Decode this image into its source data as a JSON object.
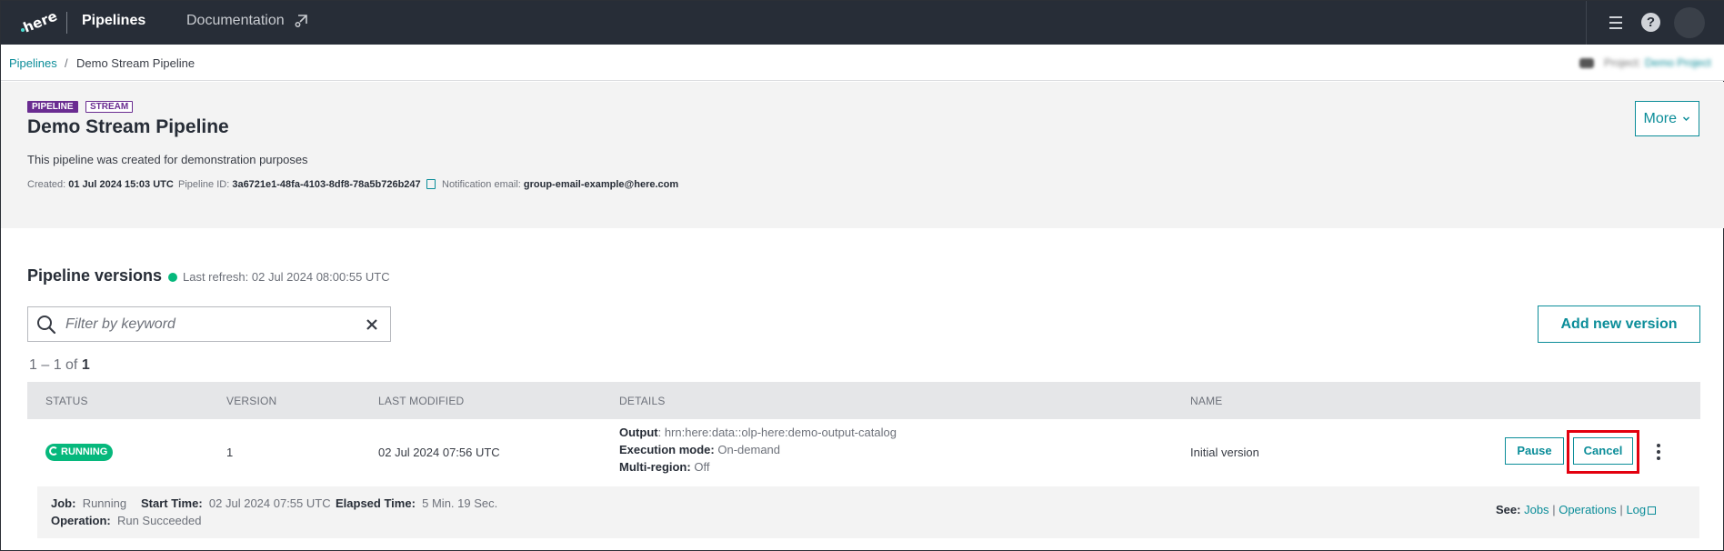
{
  "topbar": {
    "logo_text": "here",
    "app_title": "Pipelines",
    "documentation_label": "Documentation"
  },
  "breadcrumb": {
    "root": "Pipelines",
    "separator": "/",
    "current": "Demo Stream Pipeline",
    "project_label": "Project:",
    "project_value": "Demo Project"
  },
  "pipeline": {
    "tag_pipeline": "PIPELINE",
    "tag_stream": "STREAM",
    "title": "Demo Stream Pipeline",
    "description": "This pipeline was created for demonstration purposes",
    "created_label": "Created:",
    "created_value": "01 Jul 2024 15:03 UTC",
    "id_label": "Pipeline ID:",
    "id_value": "3a6721e1-48fa-4103-8df8-78a5b726b247",
    "email_label": "Notification email:",
    "email_value": "group-email-example@here.com",
    "more_label": "More"
  },
  "versions": {
    "title": "Pipeline versions",
    "last_refresh": "Last refresh: 02 Jul 2024 08:00:55 UTC",
    "search_placeholder": "Filter by keyword",
    "add_label": "Add new version",
    "count_prefix": "1 – 1 of",
    "count_total": "1",
    "columns": [
      "STATUS",
      "VERSION",
      "LAST MODIFIED",
      "DETAILS",
      "NAME"
    ],
    "rows": [
      {
        "status": "RUNNING",
        "version": "1",
        "last_modified": "02 Jul 2024 07:56 UTC",
        "output_label": "Output",
        "output_value": ": hrn:here:data::olp-here:demo-output-catalog",
        "exec_label": "Execution mode:",
        "exec_value": " On-demand",
        "region_label": "Multi-region:",
        "region_value": " Off",
        "name": "Initial version",
        "pause_label": "Pause",
        "cancel_label": "Cancel",
        "job_label": "Job:",
        "job_value": "Running",
        "start_label": "Start Time:",
        "start_value": "02 Jul 2024 07:55 UTC",
        "elapsed_label": "Elapsed Time:",
        "elapsed_value": "5 Min. 19 Sec.",
        "operation_label": "Operation:",
        "operation_value": "Run Succeeded",
        "see_label": "See:",
        "link_jobs": "Jobs",
        "link_operations": "Operations",
        "link_log": "Log",
        "link_sep": "|"
      }
    ]
  },
  "colors": {
    "accent": "#0b8d99",
    "topbar": "#272d37",
    "running": "#06b87c",
    "tag_purple": "#6a2c91",
    "highlight": "#e3000f"
  }
}
